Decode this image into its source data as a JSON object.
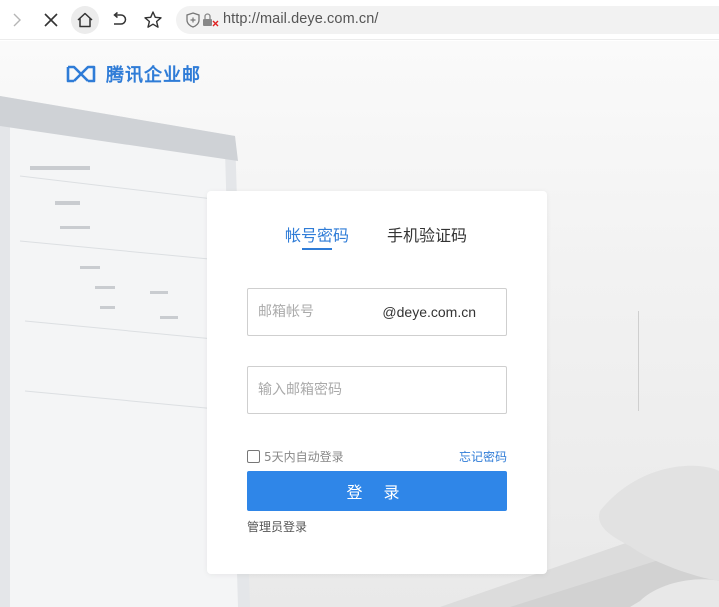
{
  "browser": {
    "url": "http://mail.deye.com.cn/"
  },
  "logo": {
    "text": "腾讯企业邮"
  },
  "login": {
    "tabs": [
      {
        "label": "帐号密码",
        "active": true
      },
      {
        "label": "手机验证码",
        "active": false
      }
    ],
    "account_placeholder": "邮箱帐号",
    "account_suffix": "@deye.com.cn",
    "password_placeholder": "输入邮箱密码",
    "remember_label": "5天内自动登录",
    "forgot_label": "忘记密码",
    "login_button": "登 录",
    "admin_link": "管理员登录"
  },
  "colors": {
    "accent": "#2f7cd7",
    "button": "#2f86e8"
  }
}
